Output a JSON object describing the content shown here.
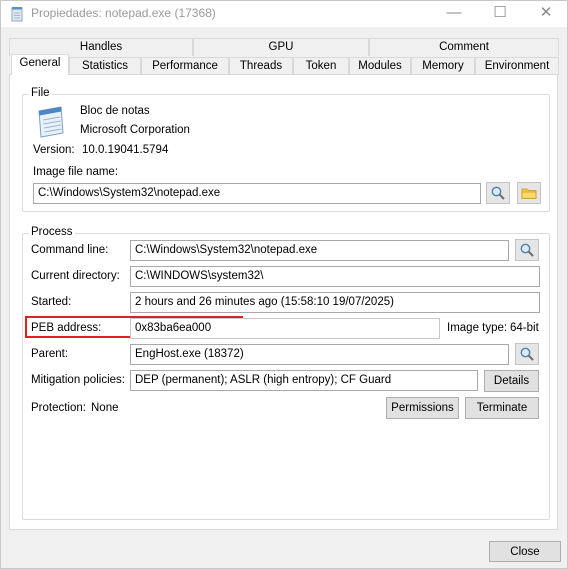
{
  "window": {
    "title": "Propiedades: notepad.exe (17368)",
    "minimize": "—",
    "maximize": "☐",
    "close": "✕"
  },
  "tabs": {
    "row1": [
      "Handles",
      "GPU",
      "Comment"
    ],
    "row2": [
      "General",
      "Statistics",
      "Performance",
      "Threads",
      "Token",
      "Modules",
      "Memory",
      "Environment"
    ],
    "active": "General"
  },
  "file": {
    "legend": "File",
    "description": "Bloc de notas",
    "company": "Microsoft Corporation",
    "version_label": "Version:",
    "version": "10.0.19041.5794",
    "image_label": "Image file name:",
    "image_path": "C:\\Windows\\System32\\notepad.exe"
  },
  "process": {
    "legend": "Process",
    "command_line_label": "Command line:",
    "command_line": "C:\\Windows\\System32\\notepad.exe",
    "current_dir_label": "Current directory:",
    "current_dir": "C:\\WINDOWS\\system32\\",
    "started_label": "Started:",
    "started": "2 hours and 26 minutes ago (15:58:10 19/07/2025)",
    "peb_label": "PEB address:",
    "peb": "0x83ba6ea000",
    "image_type_label": "Image type:",
    "image_type": "64-bit",
    "parent_label": "Parent:",
    "parent": "EngHost.exe (18372)",
    "mitigation_label": "Mitigation policies:",
    "mitigation": "DEP (permanent); ASLR (high entropy); CF Guard",
    "details_button": "Details",
    "protection_label": "Protection:",
    "protection": "None",
    "permissions_button": "Permissions",
    "terminate_button": "Terminate"
  },
  "footer": {
    "close_button": "Close"
  }
}
